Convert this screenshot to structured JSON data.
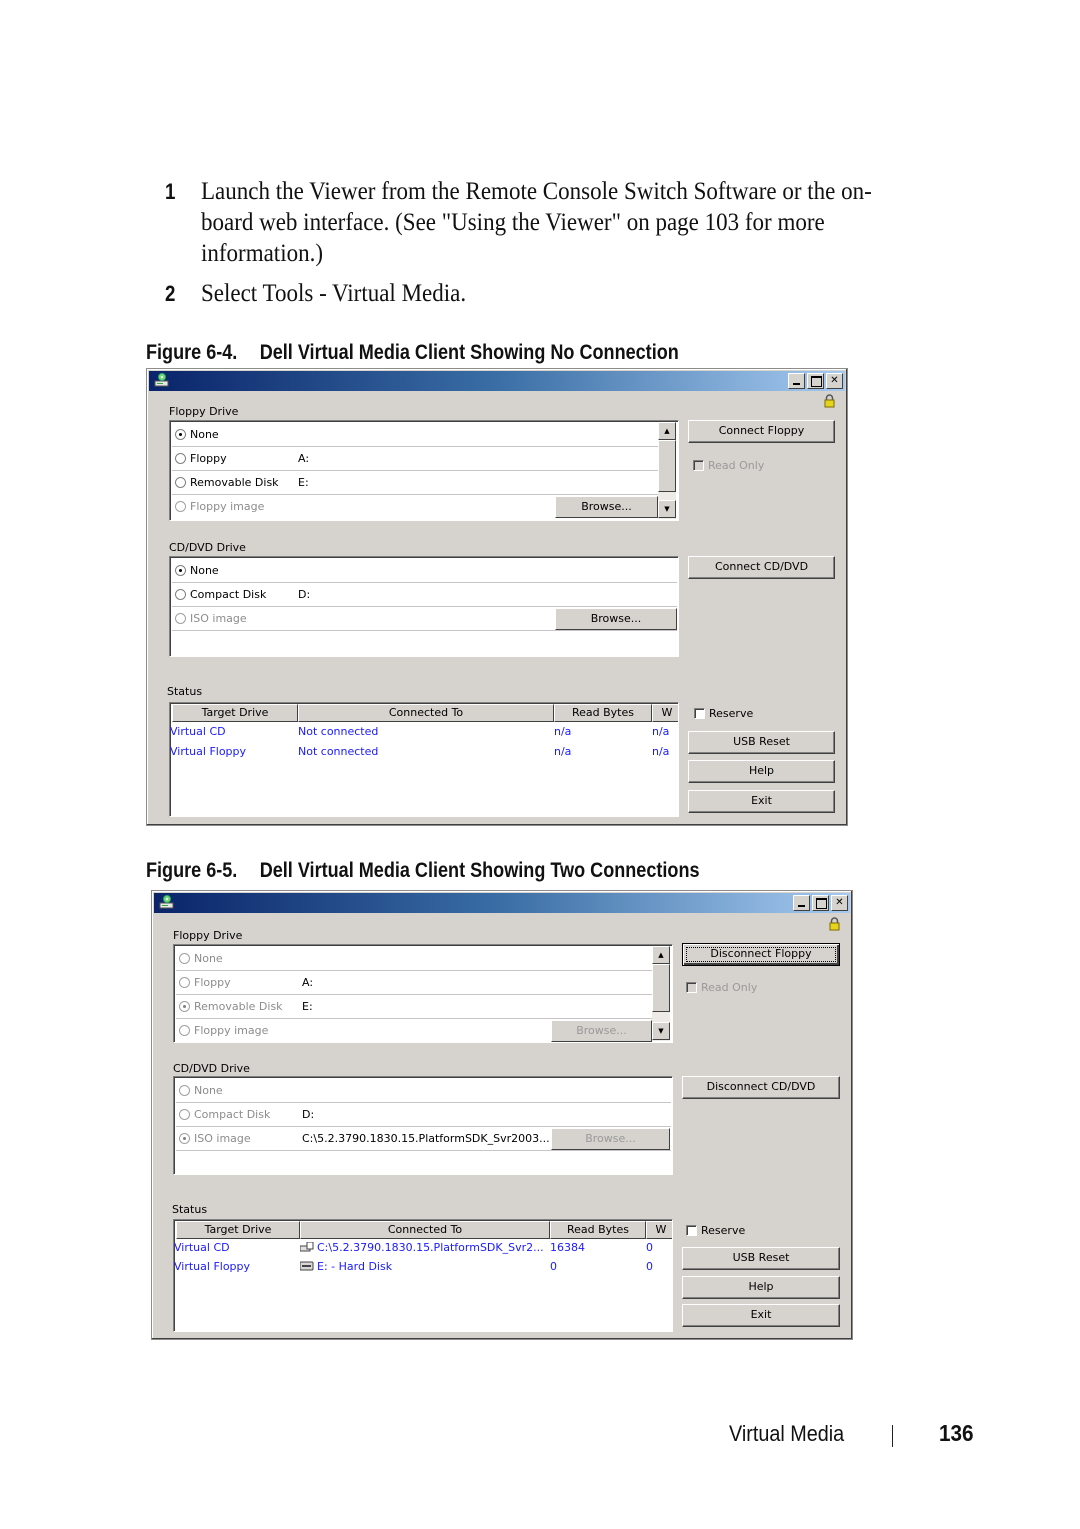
{
  "steps": [
    {
      "number": "1",
      "text": "Launch the Viewer from the Remote Console Switch Software or the on-board web interface. (See \"Using the Viewer\" on page 103 for more information.)"
    },
    {
      "number": "2",
      "text": "Select Tools - Virtual Media."
    }
  ],
  "figures": [
    {
      "caption_number": "Figure 6-4.",
      "caption_title": "Dell Virtual Media Client Showing No Connection",
      "window": {
        "title_icons": {
          "app": "virtual-media-app-icon",
          "minimize": "minimize-icon",
          "maximize": "maximize-icon",
          "close": "close-icon",
          "lock": "lock-icon"
        },
        "close_glyph": "✕",
        "floppy": {
          "label": "Floppy Drive",
          "rows": [
            {
              "label": "None",
              "drive": "",
              "selected": true,
              "disabled": false
            },
            {
              "label": "Floppy",
              "drive": "A:",
              "selected": false,
              "disabled": false
            },
            {
              "label": "Removable Disk",
              "drive": "E:",
              "selected": false,
              "disabled": false
            },
            {
              "label": "Floppy image",
              "drive": "",
              "selected": false,
              "disabled": true
            }
          ],
          "browse_label": "Browse...",
          "connect_label": "Connect Floppy",
          "read_only_label": "Read Only"
        },
        "cd": {
          "label": "CD/DVD Drive",
          "rows": [
            {
              "label": "None",
              "drive": "",
              "selected": true,
              "disabled": false
            },
            {
              "label": "Compact Disk",
              "drive": "D:",
              "selected": false,
              "disabled": false
            },
            {
              "label": "ISO image",
              "drive": "",
              "selected": false,
              "disabled": true
            }
          ],
          "browse_label": "Browse...",
          "connect_label": "Connect CD/DVD"
        },
        "status": {
          "label": "Status",
          "columns": [
            "Target Drive",
            "Connected To",
            "Read Bytes",
            "W"
          ],
          "rows": [
            {
              "target": "Virtual CD",
              "connected_to": "Not connected",
              "read_bytes": "n/a",
              "write_bytes": "n/a"
            },
            {
              "target": "Virtual Floppy",
              "connected_to": "Not connected",
              "read_bytes": "n/a",
              "write_bytes": "n/a"
            }
          ]
        },
        "reserve_label": "Reserve",
        "usb_reset_label": "USB Reset",
        "help_label": "Help",
        "exit_label": "Exit"
      }
    },
    {
      "caption_number": "Figure 6-5.",
      "caption_title": "Dell Virtual Media Client Showing Two Connections",
      "window": {
        "close_glyph": "✕",
        "floppy": {
          "label": "Floppy Drive",
          "rows": [
            {
              "label": "None",
              "drive": "",
              "selected": false,
              "disabled": true
            },
            {
              "label": "Floppy",
              "drive": "A:",
              "selected": false,
              "disabled": true
            },
            {
              "label": "Removable Disk",
              "drive": "E:",
              "selected": true,
              "disabled": true
            },
            {
              "label": "Floppy image",
              "drive": "",
              "selected": false,
              "disabled": true
            }
          ],
          "browse_label": "Browse...",
          "connect_label": "Disconnect Floppy",
          "read_only_label": "Read Only"
        },
        "cd": {
          "label": "CD/DVD Drive",
          "rows": [
            {
              "label": "None",
              "drive": "",
              "selected": false,
              "disabled": true
            },
            {
              "label": "Compact Disk",
              "drive": "D:",
              "selected": false,
              "disabled": true
            },
            {
              "label": "ISO image",
              "drive": "C:\\5.2.3790.1830.15.PlatformSDK_Svr2003...",
              "selected": true,
              "disabled": true
            }
          ],
          "browse_label": "Browse...",
          "connect_label": "Disconnect CD/DVD"
        },
        "status": {
          "label": "Status",
          "columns": [
            "Target Drive",
            "Connected To",
            "Read Bytes",
            "W"
          ],
          "rows": [
            {
              "target": "Virtual CD",
              "connected_to": "C:\\5.2.3790.1830.15.PlatformSDK_Svr2...",
              "read_bytes": "16384",
              "write_bytes": "0",
              "icon": "cd-image-icon"
            },
            {
              "target": "Virtual Floppy",
              "connected_to": "E: - Hard Disk",
              "read_bytes": "0",
              "write_bytes": "0",
              "icon": "hard-disk-icon"
            }
          ]
        },
        "reserve_label": "Reserve",
        "usb_reset_label": "USB Reset",
        "help_label": "Help",
        "exit_label": "Exit"
      }
    }
  ],
  "footer": {
    "section": "Virtual Media",
    "page": "136"
  },
  "colors": {
    "titlebar_start": "#0a246a",
    "titlebar_end": "#a6caf0",
    "window_bg": "#d6d3ce",
    "status_text": "#1a1aff"
  }
}
